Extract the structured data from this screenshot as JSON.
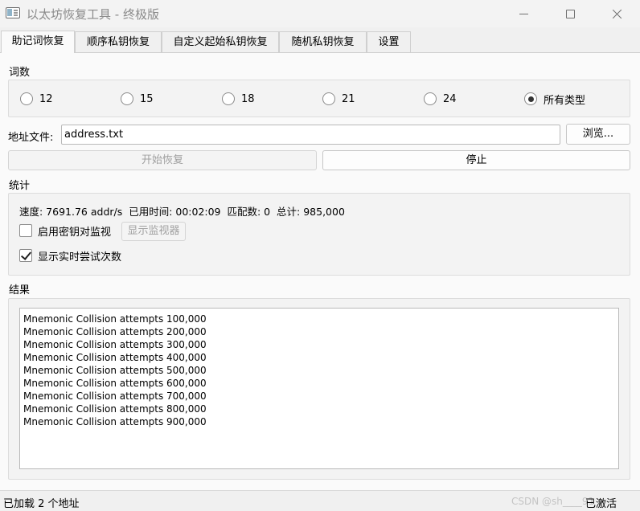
{
  "window": {
    "title": "以太坊恢复工具 - 终极版"
  },
  "tabs": [
    {
      "label": "助记词恢复",
      "active": true
    },
    {
      "label": "顺序私钥恢复",
      "active": false
    },
    {
      "label": "自定义起始私钥恢复",
      "active": false
    },
    {
      "label": "随机私钥恢复",
      "active": false
    },
    {
      "label": "设置",
      "active": false
    }
  ],
  "word_count": {
    "label": "词数",
    "options": [
      {
        "label": "12",
        "checked": false
      },
      {
        "label": "15",
        "checked": false
      },
      {
        "label": "18",
        "checked": false
      },
      {
        "label": "21",
        "checked": false
      },
      {
        "label": "24",
        "checked": false
      },
      {
        "label": "所有类型",
        "checked": true
      }
    ]
  },
  "address_file": {
    "label": "地址文件:",
    "value": "address.txt",
    "browse_label": "浏览..."
  },
  "actions": {
    "start_label": "开始恢复",
    "start_enabled": false,
    "stop_label": "停止",
    "stop_enabled": true
  },
  "stats": {
    "label": "统计",
    "summary": "速度: 7691.76 addr/s  已用时间: 00:02:09  匹配数: 0  总计: 985,000",
    "key_monitor_label": "启用密钥对监视",
    "key_monitor_checked": false,
    "show_monitor_label": "显示监视器",
    "show_attempts_label": "显示实时尝试次数",
    "show_attempts_checked": true
  },
  "results": {
    "label": "结果",
    "lines": [
      "Mnemonic Collision attempts 100,000",
      "Mnemonic Collision attempts 200,000",
      "Mnemonic Collision attempts 300,000",
      "Mnemonic Collision attempts 400,000",
      "Mnemonic Collision attempts 500,000",
      "Mnemonic Collision attempts 600,000",
      "Mnemonic Collision attempts 700,000",
      "Mnemonic Collision attempts 800,000",
      "Mnemonic Collision attempts 900,000"
    ]
  },
  "statusbar": {
    "message": "已加载 2 个地址",
    "activation": "已激活",
    "watermark": "CSDN @sh____91"
  },
  "icons": {
    "app": "app-window-icon",
    "minimize": "minimize-icon",
    "maximize": "maximize-icon",
    "close": "close-icon"
  }
}
